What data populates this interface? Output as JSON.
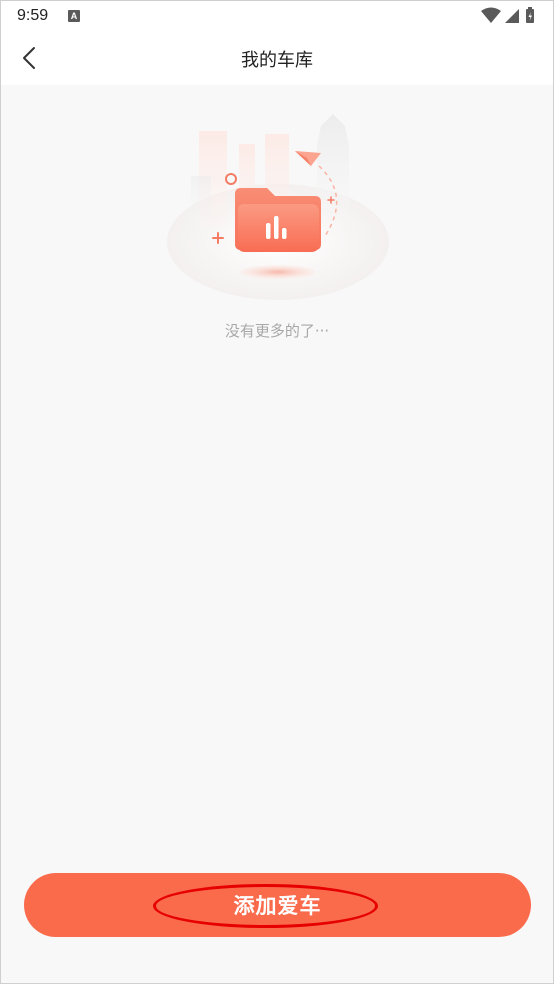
{
  "status_bar": {
    "time": "9:59",
    "notification_icon": "a-icon",
    "icons": [
      "wifi-icon",
      "signal-icon",
      "battery-icon"
    ]
  },
  "header": {
    "title": "我的车库",
    "back_icon": "chevron-left-icon"
  },
  "empty_state": {
    "illustration": "empty-folder-illustration",
    "message": "没有更多的了···"
  },
  "footer": {
    "add_car_label": "添加爱车"
  },
  "colors": {
    "accent": "#fa6b4c",
    "background": "#f8f8f8",
    "empty_text": "#a8a8a8",
    "highlight": "#e60000"
  }
}
